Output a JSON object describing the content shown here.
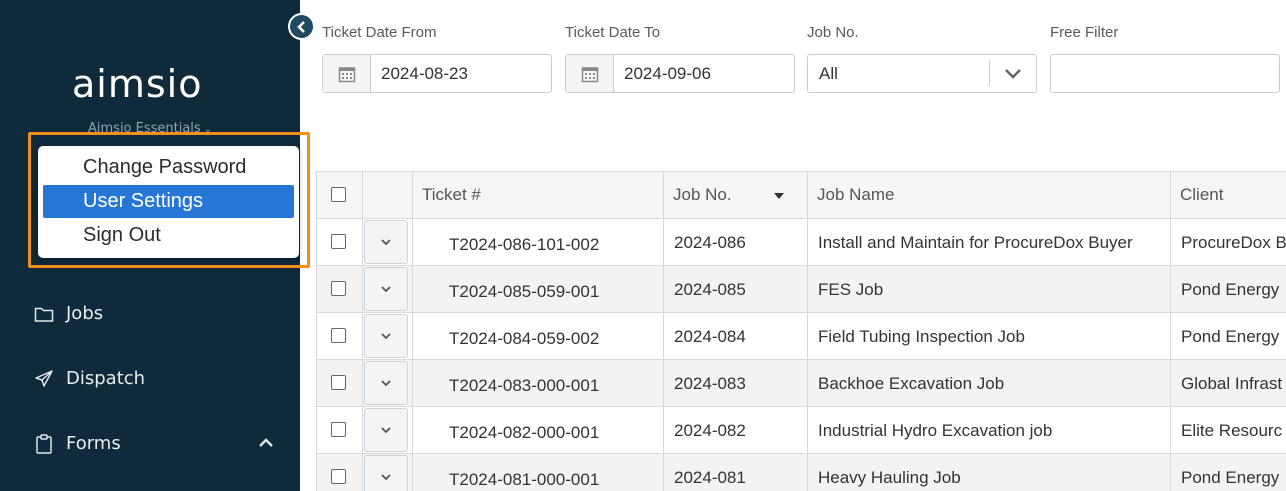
{
  "sidebar": {
    "logo_text": "aimsio",
    "org_name": "Aimsio Essentials",
    "nav": {
      "jobs": "Jobs",
      "dispatch": "Dispatch",
      "forms": "Forms"
    }
  },
  "user_menu": {
    "items": [
      "Change Password",
      "User Settings",
      "Sign Out"
    ],
    "selected": "User Settings"
  },
  "filters": {
    "date_from_label": "Ticket Date From",
    "date_from_value": "2024-08-23",
    "date_to_label": "Ticket Date To",
    "date_to_value": "2024-09-06",
    "job_no_label": "Job No.",
    "job_no_value": "All",
    "free_filter_label": "Free Filter",
    "free_filter_value": ""
  },
  "table": {
    "columns": [
      "Ticket #",
      "Job No.",
      "Job Name",
      "Client"
    ],
    "sort_column": "Job No.",
    "sort_direction": "desc",
    "rows": [
      {
        "ticket": "T2024-086-101-002",
        "job_no": "2024-086",
        "job_name": "Install and Maintain for ProcureDox Buyer",
        "client": "ProcureDox B"
      },
      {
        "ticket": "T2024-085-059-001",
        "job_no": "2024-085",
        "job_name": "FES Job",
        "client": "Pond Energy"
      },
      {
        "ticket": "T2024-084-059-002",
        "job_no": "2024-084",
        "job_name": "Field Tubing Inspection Job",
        "client": "Pond Energy"
      },
      {
        "ticket": "T2024-083-000-001",
        "job_no": "2024-083",
        "job_name": "Backhoe Excavation Job",
        "client": "Global Infrast"
      },
      {
        "ticket": "T2024-082-000-001",
        "job_no": "2024-082",
        "job_name": "Industrial Hydro Excavation job",
        "client": "Elite Resourc"
      },
      {
        "ticket": "T2024-081-000-001",
        "job_no": "2024-081",
        "job_name": "Heavy Hauling Job",
        "client": "Pond Energy"
      }
    ]
  },
  "colors": {
    "sidebar_bg": "#0e2a3b",
    "menu_highlight": "#2676d6",
    "focus_outline": "#f0901e"
  }
}
